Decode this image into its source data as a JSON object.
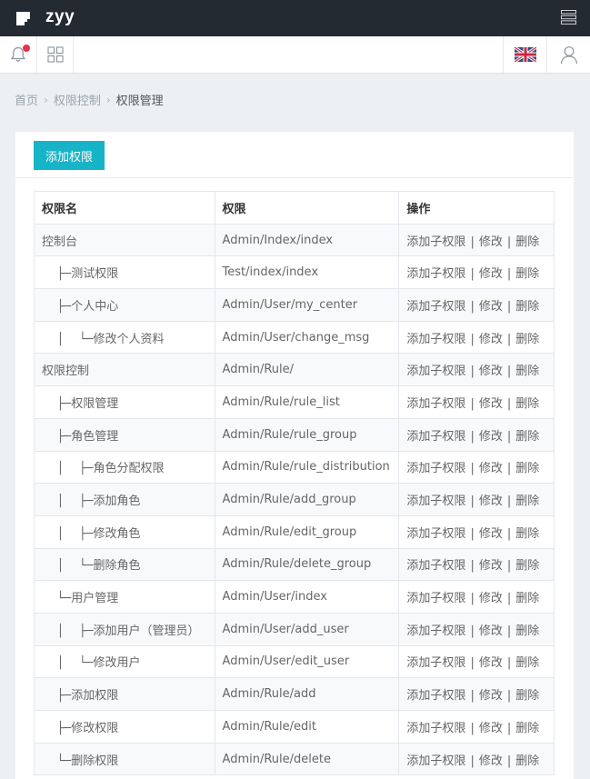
{
  "app": {
    "title": "zyy"
  },
  "icons": {
    "logo": "logo-icon",
    "menu": "menu-icon",
    "bell": "bell-icon",
    "grid": "grid-icon",
    "flag": "uk-flag-icon",
    "user": "user-icon"
  },
  "colors": {
    "topbar": "#232a32",
    "accent": "#17b4c8",
    "badge": "#e8334a"
  },
  "breadcrumb": {
    "home": "首页",
    "section": "权限控制",
    "current": "权限管理"
  },
  "card": {
    "add_button": "添加权限"
  },
  "table": {
    "headers": [
      "权限名",
      "权限",
      "操作"
    ],
    "ops": {
      "add_child": "添加子权限",
      "edit": "修改",
      "delete": "删除",
      "sep": "|"
    },
    "rows": [
      {
        "prefix": "",
        "name": "控制台",
        "rule": "Admin/Index/index"
      },
      {
        "prefix": "    ├─",
        "name": "测试权限",
        "rule": "Test/index/index"
      },
      {
        "prefix": "    ├─",
        "name": "个人中心",
        "rule": "Admin/User/my_center"
      },
      {
        "prefix": "    │    └─",
        "name": "修改个人资料",
        "rule": "Admin/User/change_msg"
      },
      {
        "prefix": "",
        "name": "权限控制",
        "rule": "Admin/Rule/"
      },
      {
        "prefix": "    ├─",
        "name": "权限管理",
        "rule": "Admin/Rule/rule_list"
      },
      {
        "prefix": "    ├─",
        "name": "角色管理",
        "rule": "Admin/Rule/rule_group"
      },
      {
        "prefix": "    │    ├─",
        "name": "角色分配权限",
        "rule": "Admin/Rule/rule_distribution"
      },
      {
        "prefix": "    │    ├─",
        "name": "添加角色",
        "rule": "Admin/Rule/add_group"
      },
      {
        "prefix": "    │    ├─",
        "name": "修改角色",
        "rule": "Admin/Rule/edit_group"
      },
      {
        "prefix": "    │    └─",
        "name": "删除角色",
        "rule": "Admin/Rule/delete_group"
      },
      {
        "prefix": "    └─",
        "name": "用户管理",
        "rule": "Admin/User/index"
      },
      {
        "prefix": "    │    ├─",
        "name": "添加用户（管理员）",
        "rule": "Admin/User/add_user"
      },
      {
        "prefix": "    │    └─",
        "name": "修改用户",
        "rule": "Admin/User/edit_user"
      },
      {
        "prefix": "    ├─",
        "name": "添加权限",
        "rule": "Admin/Rule/add"
      },
      {
        "prefix": "    ├─",
        "name": "修改权限",
        "rule": "Admin/Rule/edit"
      },
      {
        "prefix": "    └─",
        "name": "删除权限",
        "rule": "Admin/Rule/delete"
      }
    ]
  }
}
